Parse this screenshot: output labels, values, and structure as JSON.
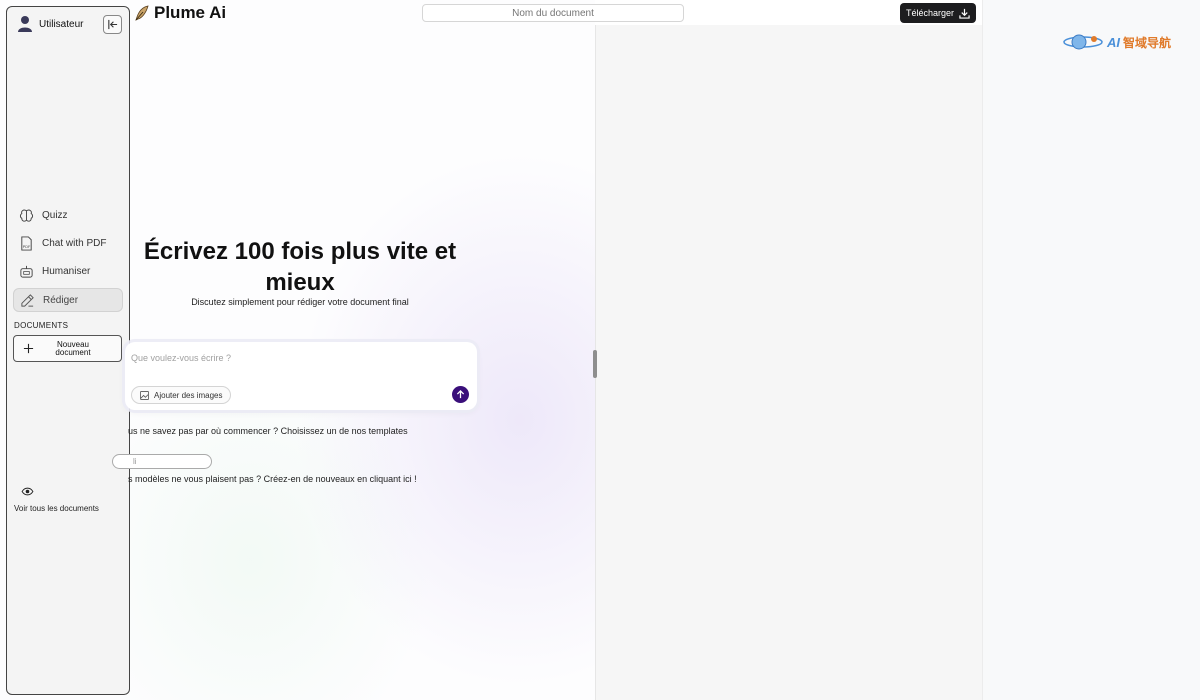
{
  "app": {
    "brand": "Plume Ai"
  },
  "header": {
    "document_name_placeholder": "Nom du document",
    "download_label": "Télécharger"
  },
  "watermark": {
    "latin": "AI",
    "cn": "智域导航"
  },
  "sidebar": {
    "user_label": "Utilisateur",
    "items": [
      {
        "label": "Quizz",
        "icon": "brain-icon"
      },
      {
        "label": "Chat with PDF",
        "icon": "pdf-file-icon"
      },
      {
        "label": "Humaniser",
        "icon": "robot-icon"
      },
      {
        "label": "Rédiger",
        "icon": "pencil-icon",
        "active": true
      }
    ],
    "documents_heading": "DOCUMENTS",
    "new_document_label": "Nouveau document",
    "view_all_label": "Voir tous les documents"
  },
  "hero": {
    "title": "Écrivez 100 fois plus vite et mieux",
    "subtitle": "Discutez simplement pour rédiger votre document final"
  },
  "prompt": {
    "placeholder": "Que voulez-vous écrire ?",
    "add_images_label": "Ajouter des images"
  },
  "templates": {
    "prompt_text": "us ne savez pas par où commencer ? Choisissez un de nos templates",
    "search_value": "li",
    "create_text": "s modèles ne vous plaisent pas ? Créez-en de nouveaux en cliquant ici !"
  },
  "colors": {
    "accent": "#3a0f7a",
    "download_bg": "#1d1d1f",
    "sidebar_bg": "#f4f4f4"
  }
}
